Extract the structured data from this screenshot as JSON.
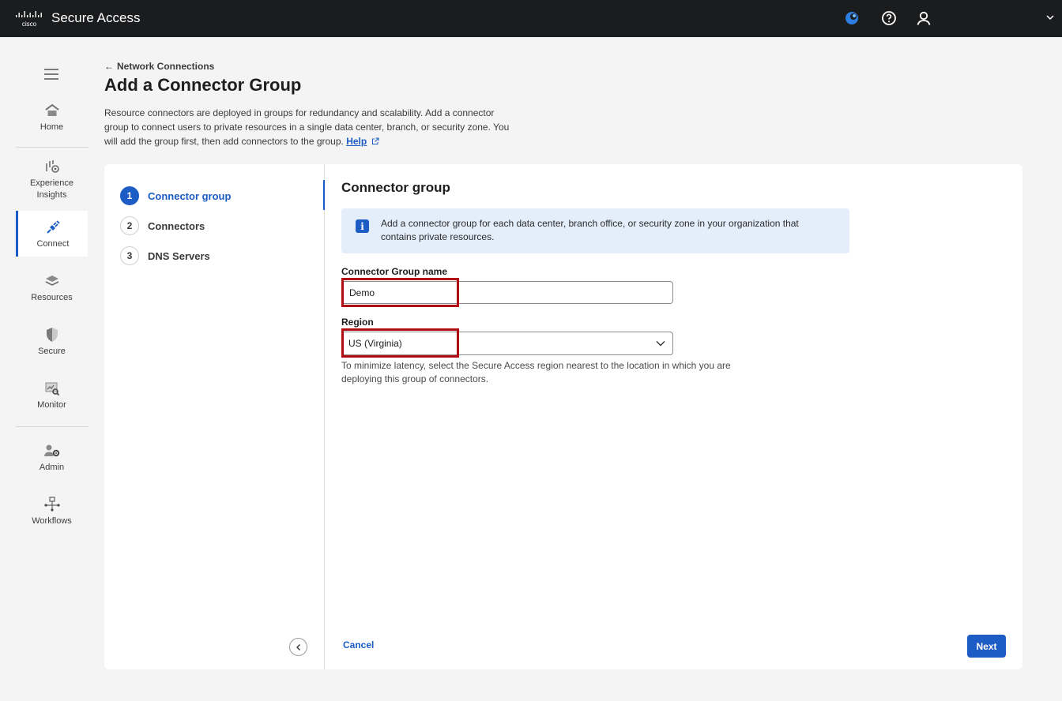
{
  "topbar": {
    "title": "Secure Access",
    "icons": [
      "cisco-logo",
      "status-icon",
      "help-icon",
      "user-icon",
      "chevron-down-icon"
    ],
    "brand_color": "#1d5cc4"
  },
  "nav": {
    "items": [
      {
        "label": "Home",
        "icon": "home-icon"
      },
      {
        "label": "Experience Insights",
        "icon": "insights-icon"
      },
      {
        "label": "Connect",
        "icon": "connect-icon",
        "active": true
      },
      {
        "label": "Resources",
        "icon": "resources-icon"
      },
      {
        "label": "Secure",
        "icon": "shield-icon"
      },
      {
        "label": "Monitor",
        "icon": "monitor-icon"
      },
      {
        "label": "Admin",
        "icon": "admin-icon"
      },
      {
        "label": "Workflows",
        "icon": "workflows-icon"
      }
    ]
  },
  "header": {
    "breadcrumb": "Network Connections",
    "title": "Add a Connector Group",
    "description": "Resource connectors are deployed in groups for redundancy and scalability. Add a connector group to connect users to private resources in a single data center, branch, or security zone. You will add the group first, then add connectors to the group.",
    "help_label": "Help"
  },
  "steps": [
    {
      "num": "1",
      "label": "Connector group",
      "active": true
    },
    {
      "num": "2",
      "label": "Connectors"
    },
    {
      "num": "3",
      "label": "DNS Servers"
    }
  ],
  "form": {
    "section_title": "Connector group",
    "info_text": "Add a connector group for each data center, branch office, or security zone in your organization that contains private resources.",
    "group_name_label": "Connector Group name",
    "group_name_value": "Demo",
    "region_label": "Region",
    "region_value": "US (Virginia)",
    "region_helper": "To minimize latency, select the Secure Access region nearest to the location in which you are deploying this group of connectors.",
    "cancel_label": "Cancel",
    "next_label": "Next"
  }
}
